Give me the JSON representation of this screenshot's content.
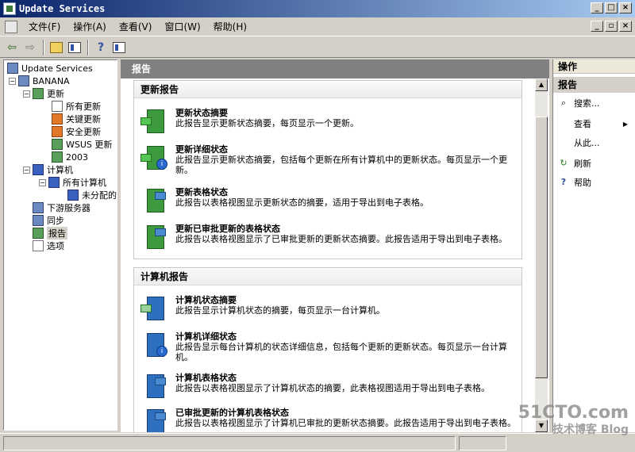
{
  "window": {
    "title": "Update Services"
  },
  "menu": [
    {
      "label": "文件(F)"
    },
    {
      "label": "操作(A)"
    },
    {
      "label": "查看(V)"
    },
    {
      "label": "窗口(W)"
    },
    {
      "label": "帮助(H)"
    }
  ],
  "tree": {
    "root": "Update Services",
    "server": "BANANA",
    "updates": "更新",
    "all_updates": "所有更新",
    "critical_updates": "关键更新",
    "security_updates": "安全更新",
    "wsus_updates": "WSUS 更新",
    "y2003": "2003",
    "computers": "计算机",
    "all_computers": "所有计算机",
    "unassigned": "未分配的",
    "downstream": "下游服务器",
    "sync": "同步",
    "reports": "报告",
    "options": "选项"
  },
  "center": {
    "header": "报告",
    "sections": [
      {
        "title": "更新报告",
        "reports": [
          {
            "title": "更新状态摘要",
            "desc": "此报告显示更新状态摘要，每页显示一个更新。"
          },
          {
            "title": "更新详细状态",
            "desc": "此报告显示更新状态摘要，包括每个更新在所有计算机中的更新状态。每页显示一个更新。"
          },
          {
            "title": "更新表格状态",
            "desc": "此报告以表格视图显示更新状态的摘要，适用于导出到电子表格。"
          },
          {
            "title": "更新已审批更新的表格状态",
            "desc": "此报告以表格视图显示了已审批更新的更新状态摘要。此报告适用于导出到电子表格。"
          }
        ]
      },
      {
        "title": "计算机报告",
        "reports": [
          {
            "title": "计算机状态摘要",
            "desc": "此报告显示计算机状态的摘要，每页显示一台计算机。"
          },
          {
            "title": "计算机详细状态",
            "desc": "此报告显示每台计算机的状态详细信息，包括每个更新的更新状态。每页显示一台计算机。"
          },
          {
            "title": "计算机表格状态",
            "desc": "此报告以表格视图显示了计算机状态的摘要，此表格视图适用于导出到电子表格。"
          },
          {
            "title": "已审批更新的计算机表格状态",
            "desc": "此报告以表格视图显示了计算机已审批的更新状态摘要。此报告适用于导出到电子表格。"
          }
        ]
      }
    ]
  },
  "actions": {
    "header": "操作",
    "section": "报告",
    "items": [
      {
        "label": "搜索...",
        "icon": "search-icon"
      },
      {
        "label": "查看",
        "icon": ""
      },
      {
        "label": "从此...",
        "icon": ""
      },
      {
        "label": "刷新",
        "icon": "refresh-icon"
      },
      {
        "label": "帮助",
        "icon": "help-icon"
      }
    ]
  },
  "watermark": {
    "main": "51CTO.com",
    "sub": "技术博客 Blog"
  }
}
